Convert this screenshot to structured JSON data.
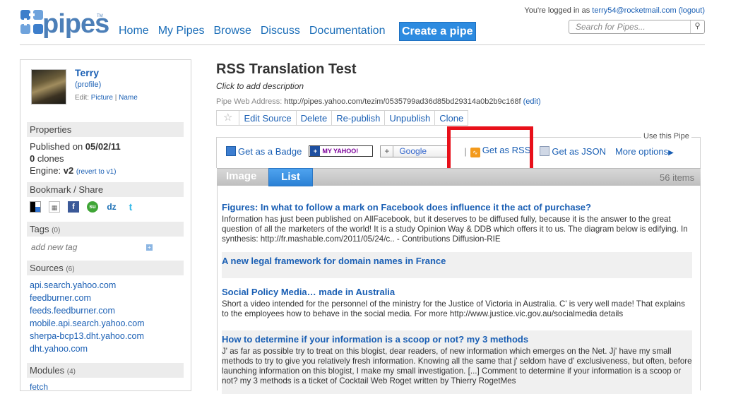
{
  "header": {
    "logo_text": "pipes",
    "logo_tm": "TM",
    "nav": [
      "Home",
      "My Pipes",
      "Browse",
      "Discuss",
      "Documentation"
    ],
    "create_button": "Create a pipe",
    "login_prefix": "You're logged in as",
    "login_email": "terry54@rocketmail.com",
    "logout": "(logout)",
    "search_placeholder": "Search for Pipes..."
  },
  "sidebar": {
    "user_name": "Terry",
    "profile_link": "(profile)",
    "edit_prefix": "Edit:",
    "edit_picture": "Picture",
    "edit_sep": "|",
    "edit_name": "Name",
    "properties_title": "Properties",
    "published_label": "Published on",
    "published_date": "05/02/11",
    "clones_count": "0",
    "clones_label": "clones",
    "engine_label": "Engine:",
    "engine_version": "v2",
    "revert_link": "(revert to v1)",
    "bookmark_title": "Bookmark / Share",
    "share_icons": [
      "delicious-icon",
      "digg-icon",
      "facebook-icon",
      "stumbleupon-icon",
      "dzone-icon",
      "twitter-icon"
    ],
    "tags_title": "Tags",
    "tags_count": "(0)",
    "add_tag": "add new tag",
    "sources_title": "Sources",
    "sources_count": "(6)",
    "sources": [
      "api.search.yahoo.com",
      "feedburner.com",
      "feeds.feedburner.com",
      "mobile.api.search.yahoo.com",
      "sherpa-bcp13.dht.yahoo.com",
      "dht.yahoo.com"
    ],
    "modules_title": "Modules",
    "modules_count": "(4)",
    "modules_first": "fetch"
  },
  "main": {
    "title": "RSS Translation Test",
    "description": "Click to add description",
    "address_label": "Pipe Web Address:",
    "address_url": "http://pipes.yahoo.com/tezim/0535799ad36d85bd29314a0b2b9c168f",
    "address_edit": "(edit)",
    "actions": [
      "Edit Source",
      "Delete",
      "Re-publish",
      "Unpublish",
      "Clone"
    ],
    "use_label": "Use this Pipe",
    "get_badge": "Get as a Badge",
    "my_yahoo": "MY YAHOO!",
    "google": "Google",
    "get_rss": "Get as RSS",
    "get_json": "Get as JSON",
    "more_options": "More options",
    "tabs": [
      "Image",
      "List"
    ],
    "item_count": "56 items",
    "results": [
      {
        "title": "Figures: In what to follow a mark on Facebook does influence it the act of purchase?",
        "desc": "Information has just been published on AllFacebook, but it deserves to be diffused fully, because it is the answer to the great question of all the marketers of the world! It is a study Opinion Way & DDB which offers it to us. The diagram below is edifying. In synthesis: http://fr.mashable.com/2011/05/24/c.. - Contributions Diffusion-RIE"
      },
      {
        "title": "A new legal framework for domain names in France",
        "desc": ""
      },
      {
        "title": "Social Policy Media… made in Australia",
        "desc": "Short a video intended for the personnel of the ministry for the Justice of Victoria in Australia. C' is very well made! That explains to the employees how to behave in the social media. For more http://www.justice.vic.gov.au/socialmedia details"
      },
      {
        "title": "How to determine if your information is a scoop or not? my 3 methods",
        "desc": "J' as far as possible try to treat on this blogist, dear readers, of new information which emerges on the Net. Jj' have my small methods to try to give you relatively fresh information. Knowing all the same that j' seldom have d' exclusiveness, but often, before launching information on this blogist, I make my small investigation. [...] Comment to determine if your information is a scoop or not? my 3 methods is a ticket of Cocktail Web Roget written by Thierry RogetMes"
      }
    ]
  },
  "colors": {
    "link": "#1a5fb4",
    "create_button_bg": "#2d8be0",
    "highlight": "#e8101a",
    "tab_active": "#2b81d5"
  }
}
